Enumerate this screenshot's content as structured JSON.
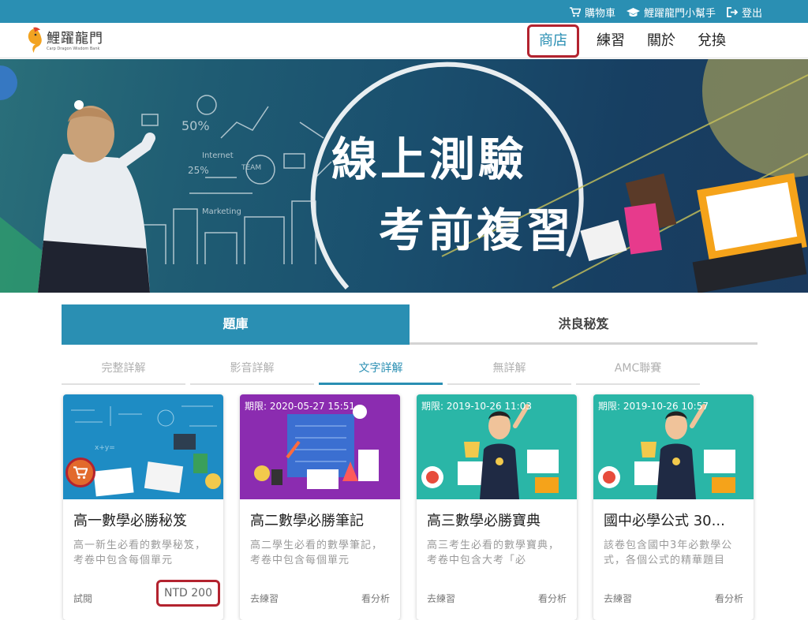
{
  "topbar": {
    "cart": "購物車",
    "helper": "鯉躍龍門小幫手",
    "logout": "登出"
  },
  "logo": {
    "title": "鯉躍龍門",
    "subtitle": "Carp Dragon Wisdom Bank"
  },
  "nav": {
    "items": [
      "商店",
      "練習",
      "關於",
      "兌換"
    ],
    "active": "商店"
  },
  "banner": {
    "line1": "線上測驗",
    "line2": "考前複習"
  },
  "category_tabs": [
    "題庫",
    "洪良秘笈"
  ],
  "sub_tabs": [
    "完整詳解",
    "影音詳解",
    "文字詳解",
    "無詳解",
    "AMC聯賽"
  ],
  "cards": [
    {
      "title": "高一數學必勝秘笈",
      "desc": "高一新生必看的數學秘笈，考卷中包含每個單元",
      "deadline": "",
      "left": "試閱",
      "right": "NTD 200"
    },
    {
      "title": "高二數學必勝筆記",
      "desc": "高二學生必看的數學筆記，考卷中包含每個單元",
      "deadline": "期限: 2020-05-27 15:51",
      "left": "去練習",
      "right": "看分析"
    },
    {
      "title": "高三數學必勝寶典",
      "desc": "高三考生必看的數學寶典，考卷中包含大考「必",
      "deadline": "期限: 2019-10-26 11:03",
      "left": "去練習",
      "right": "看分析"
    },
    {
      "title": "國中必學公式 30...",
      "desc": "該卷包含國中3年必數學公式，各個公式的精華題目",
      "deadline": "期限: 2019-10-26 10:57",
      "left": "去練習",
      "right": "看分析"
    }
  ],
  "colors": {
    "brand": "#2a8fb3",
    "highlight": "#b3232f",
    "card2_bg": "#8b2cb0",
    "card3_bg": "#2ab6a7"
  }
}
